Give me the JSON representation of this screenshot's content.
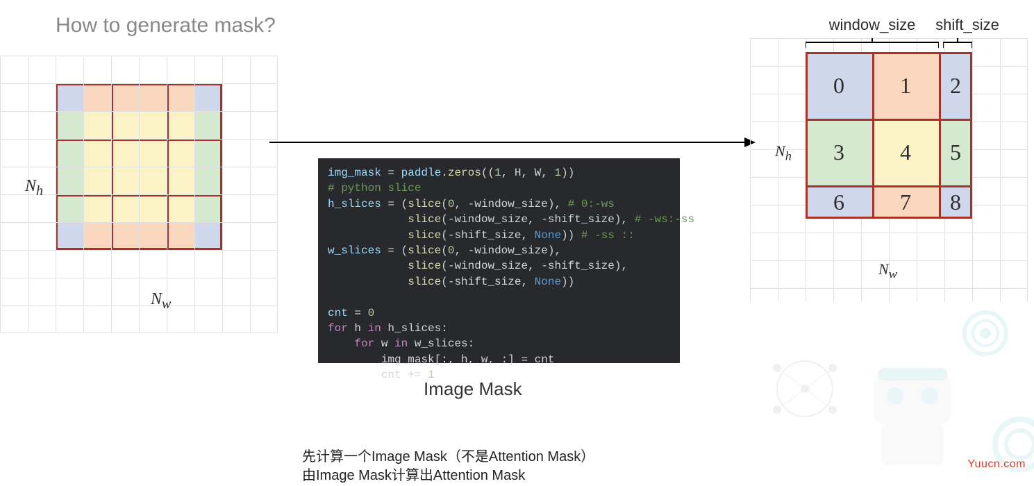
{
  "slide": {
    "title": "How to generate mask?"
  },
  "code": {
    "label": "Image Mask",
    "line1": "img_mask = paddle.zeros((1, H, W, 1))",
    "line2": "# python slice",
    "line3a": "h_slices = (slice(0, -window_size), ",
    "line3b": "# 0:-ws",
    "line4a": "            slice(-window_size, -shift_size), ",
    "line4b": "# -ws:-ss",
    "line5a": "            slice(-shift_size, None)) ",
    "line5b": "# -ss ::",
    "line6": "w_slices = (slice(0, -window_size),",
    "line7": "            slice(-window_size, -shift_size),",
    "line8": "            slice(-shift_size, None))",
    "line9": "",
    "line10": "cnt = 0",
    "line11": "for h in h_slices:",
    "line12": "    for w in w_slices:",
    "line13": "        img_mask[:, h, w, :] = cnt",
    "line14": "        cnt += 1"
  },
  "left_grid": {
    "nh_label": "N",
    "nh_sub": "h",
    "nw_label": "N",
    "nw_sub": "w"
  },
  "right_grid": {
    "nh_label": "N",
    "nh_sub": "h",
    "nw_label": "N",
    "nw_sub": "w",
    "window_size_label": "window_size",
    "shift_size_label": "shift_size",
    "cells": {
      "c0": "0",
      "c1": "1",
      "c2": "2",
      "c3": "3",
      "c4": "4",
      "c5": "5",
      "c6": "6",
      "c7": "7",
      "c8": "8"
    }
  },
  "explain": {
    "l1": "先计算一个Image Mask（不是Attention Mask）",
    "l2": "由Image Mask计算出Attention Mask"
  },
  "watermark": "Yuucn.com"
}
